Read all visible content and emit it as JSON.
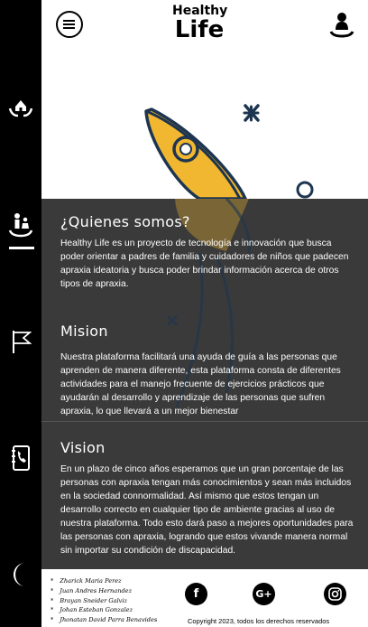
{
  "header": {
    "logo_line1": "Healthy",
    "logo_line2": "Life"
  },
  "sidebar": {
    "items": [
      {
        "icon": "home-icon"
      },
      {
        "icon": "family-icon",
        "active": true
      },
      {
        "icon": "flag-icon"
      },
      {
        "icon": "contact-book-icon"
      },
      {
        "icon": "moon-icon"
      }
    ]
  },
  "about": {
    "title": "¿Quienes somos?",
    "text": "Healthy Life es un proyecto de tecnología e innovación que busca poder orientar a padres de familia y cuidadores de niños que padecen apraxia ideatoria y busca poder brindar información acerca de otros tipos de apraxia."
  },
  "mission": {
    "title": "Mision",
    "text": "Nuestra plataforma facilitará una ayuda de guía a las personas que aprenden de manera diferente, esta plataforma consta de diferentes actividades para el manejo frecuente de ejercicios prácticos que ayudarán al desarrollo y aprendizaje de las personas que sufren apraxia, lo que llevará a un mejor bienestar"
  },
  "vision": {
    "title": "Vision",
    "text": "En un plazo de cinco años esperamos que un gran porcentaje de las personas con apraxia tengan más conocimientos y sean más incluidos en la sociedad connormalidad. Así mismo que estos tengan un desarrollo correcto en cualquier tipo de ambiente gracias al uso de nuestra plataforma. Todo esto dará paso a mejores oportunidades para las personas con apraxia, logrando que estos vivande manera normal sin importar su condición de discapacidad."
  },
  "footer": {
    "credits": [
      "Zharick Maria Perez",
      "Juan Andres Hernandez",
      "Brayan Sneider Galviz",
      "Johan Esteban Gonzalez",
      "Jhonatan David Parra Benavides"
    ],
    "social": {
      "facebook": "f",
      "google_plus": "G+"
    },
    "copyright": "Copyright 2023, todos los derechos reservados"
  },
  "colors": {
    "sidebar_bg": "#000000",
    "panel_bg": "#3a3a3a",
    "rocket_yellow": "#f2b730",
    "rocket_stroke": "#1d3550"
  }
}
